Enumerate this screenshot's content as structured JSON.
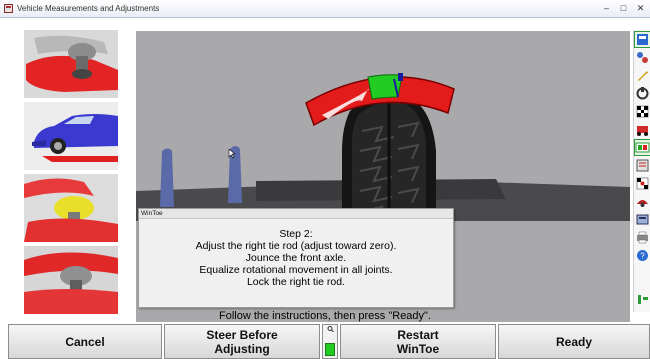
{
  "window": {
    "title": "Vehicle Measurements and Adjustments",
    "controls": {
      "minimize": "–",
      "maximize": "□",
      "close": "✕"
    }
  },
  "thumbnails": [
    {
      "name": "ball-joint-top",
      "active": false
    },
    {
      "name": "vehicle-view",
      "active": true
    },
    {
      "name": "ball-joint-yellow",
      "active": false
    },
    {
      "name": "ball-joint-bottom",
      "active": false
    }
  ],
  "dialog": {
    "title": "WinToe",
    "lines": [
      "Step 2:",
      "Adjust the right tie rod (adjust toward zero).",
      "Jounce the front axle.",
      "Equalize rotational movement in all joints.",
      "Lock the right tie rod."
    ]
  },
  "instruction": "Follow the instructions, then press \"Ready\".",
  "buttons": {
    "cancel": "Cancel",
    "steer_before": "Steer Before\nAdjusting",
    "restart": "Restart\nWinToe",
    "ready": "Ready"
  },
  "gauge": {
    "level": 0.6,
    "color": "#1fcc1f"
  },
  "toe_meter": {
    "in_range_color": "#22cc22",
    "out_of_range_color": "#e31b1b"
  },
  "toolbar_icons": [
    "vehicle-specs-icon",
    "measurements-icon",
    "wrench-icon",
    "alignment-icon",
    "checkered-flag-icon",
    "racing-icon",
    "readings-icon",
    "reports-icon",
    "toe-icon",
    "camber-icon",
    "caster-icon",
    "print-icon",
    "help-icon"
  ]
}
